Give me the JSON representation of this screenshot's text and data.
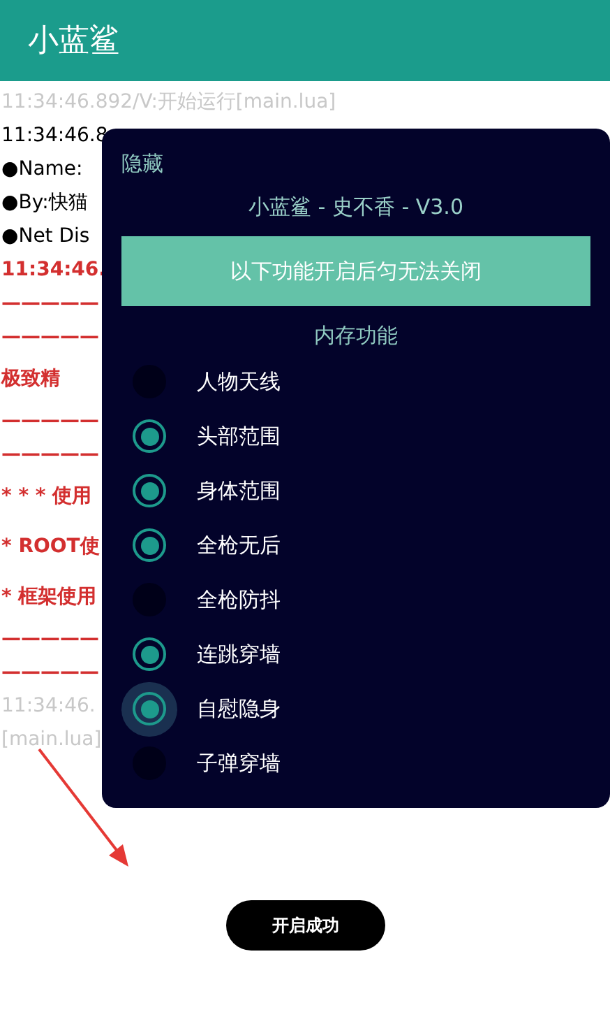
{
  "app_bar": {
    "title": "小蓝鲨"
  },
  "log": [
    {
      "text": "11:34:46.892/V:开始运行[main.lua]",
      "kind": "info"
    },
    {
      "text": "11:34:46.8",
      "kind": "plain"
    },
    {
      "text": "●Name:",
      "kind": "plain"
    },
    {
      "text": "●By:快猫",
      "kind": "plain"
    },
    {
      "text": "●Net Dis",
      "kind": "plain"
    },
    {
      "text": "11:34:46.",
      "kind": "error"
    },
    {
      "text": "—————",
      "kind": "error"
    },
    {
      "text": "—————",
      "kind": "error"
    },
    {
      "text": "极致精",
      "kind": "notice"
    },
    {
      "text": "—————",
      "kind": "error"
    },
    {
      "text": "—————",
      "kind": "error"
    },
    {
      "text": "* * * 使用",
      "kind": "notice"
    },
    {
      "text": "* ROOT使",
      "kind": "notice"
    },
    {
      "text": "* 框架使用",
      "kind": "notice"
    },
    {
      "text": "—————",
      "kind": "error"
    },
    {
      "text": "—————",
      "kind": "error"
    },
    {
      "text": "11:34:46.",
      "kind": "info"
    },
    {
      "text": "[main.lua]",
      "kind": "info"
    }
  ],
  "panel": {
    "hide_label": "隐藏",
    "title": "小蓝鲨 - 史不香 - V3.0",
    "banner": "以下功能开启后匀无法关闭",
    "section": "内存功能",
    "options": [
      {
        "label": "人物天线",
        "checked": false,
        "focused": false
      },
      {
        "label": "头部范围",
        "checked": true,
        "focused": false
      },
      {
        "label": "身体范围",
        "checked": true,
        "focused": false
      },
      {
        "label": "全枪无后",
        "checked": true,
        "focused": false
      },
      {
        "label": "全枪防抖",
        "checked": false,
        "focused": false
      },
      {
        "label": "连跳穿墙",
        "checked": true,
        "focused": false
      },
      {
        "label": "自慰隐身",
        "checked": true,
        "focused": true
      },
      {
        "label": "子弹穿墙",
        "checked": false,
        "focused": false
      }
    ]
  },
  "toast": "开启成功"
}
